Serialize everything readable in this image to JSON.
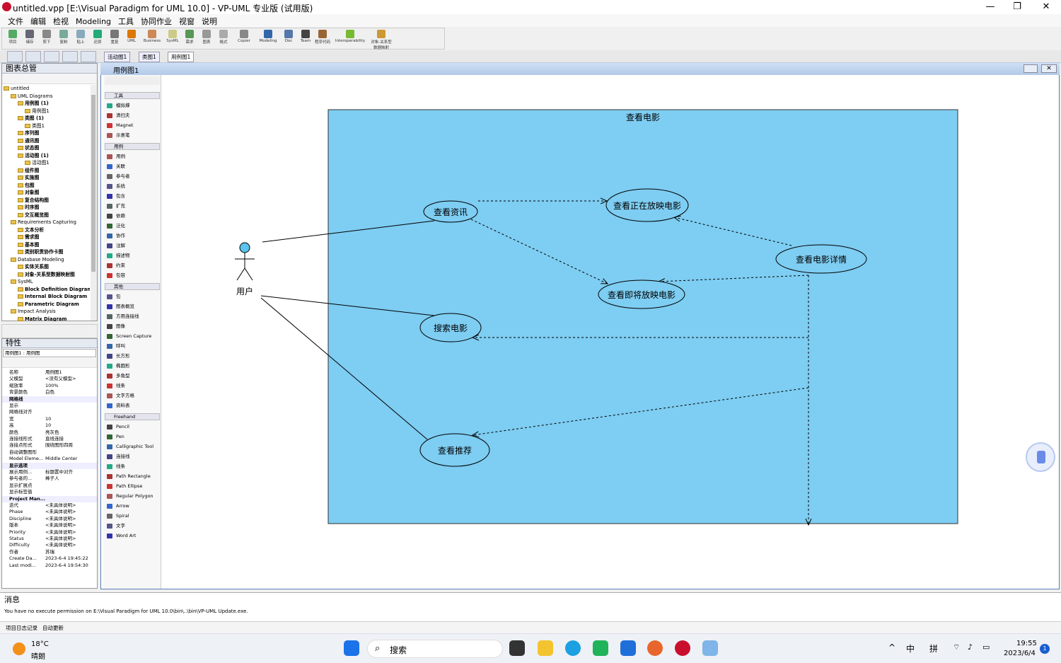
{
  "window": {
    "title": "untitled.vpp [E:\\Visual Paradigm for UML 10.0] - VP-UML 专业版 (试用版)"
  },
  "menu": [
    "文件",
    "编辑",
    "检视",
    "Modeling",
    "工具",
    "协同作业",
    "视窗",
    "说明"
  ],
  "toolbar": [
    "项目",
    "储存",
    "剪下",
    "复制",
    "贴上",
    "还原",
    "重复",
    "UML",
    "Business",
    "SysML",
    "需求",
    "图表",
    "格式",
    "Copier",
    "Modeling",
    "Doc",
    "Team",
    "程序代码",
    "Interoperability",
    "对象-关系型数据映射"
  ],
  "doc_tabs": [
    "活动图1",
    "类图1",
    "用例图1"
  ],
  "diagram_tab_title": "用例图1",
  "tree": {
    "title": "图表总管",
    "items": [
      {
        "label": "untitled",
        "level": 0,
        "bold": false
      },
      {
        "label": "UML Diagrams",
        "level": 1,
        "bold": false
      },
      {
        "label": "用例图 (1)",
        "level": 2,
        "bold": true
      },
      {
        "label": "用例图1",
        "level": 3,
        "bold": false
      },
      {
        "label": "类图 (1)",
        "level": 2,
        "bold": true
      },
      {
        "label": "类图1",
        "level": 3,
        "bold": false
      },
      {
        "label": "序列图",
        "level": 2,
        "bold": true
      },
      {
        "label": "通讯图",
        "level": 2,
        "bold": true
      },
      {
        "label": "状态图",
        "level": 2,
        "bold": true
      },
      {
        "label": "活动图 (1)",
        "level": 2,
        "bold": true
      },
      {
        "label": "活动图1",
        "level": 3,
        "bold": false
      },
      {
        "label": "组件图",
        "level": 2,
        "bold": true
      },
      {
        "label": "实施图",
        "level": 2,
        "bold": true
      },
      {
        "label": "包图",
        "level": 2,
        "bold": true
      },
      {
        "label": "对象图",
        "level": 2,
        "bold": true
      },
      {
        "label": "复合结构图",
        "level": 2,
        "bold": true
      },
      {
        "label": "时序图",
        "level": 2,
        "bold": true
      },
      {
        "label": "交互概览图",
        "level": 2,
        "bold": true
      },
      {
        "label": "Requirements Capturing",
        "level": 1,
        "bold": false
      },
      {
        "label": "文本分析",
        "level": 2,
        "bold": true
      },
      {
        "label": "需求图",
        "level": 2,
        "bold": true
      },
      {
        "label": "基本图",
        "level": 2,
        "bold": true
      },
      {
        "label": "类别职责协作卡图",
        "level": 2,
        "bold": true
      },
      {
        "label": "Database Modeling",
        "level": 1,
        "bold": false
      },
      {
        "label": "实体关系图",
        "level": 2,
        "bold": true
      },
      {
        "label": "对象-关系型数据映射图",
        "level": 2,
        "bold": true
      },
      {
        "label": "SysML",
        "level": 1,
        "bold": false
      },
      {
        "label": "Block Definition Diagram",
        "level": 2,
        "bold": true
      },
      {
        "label": "Internal Block Diagram",
        "level": 2,
        "bold": true
      },
      {
        "label": "Parametric Diagram",
        "level": 2,
        "bold": true
      },
      {
        "label": "Impact Analysis",
        "level": 1,
        "bold": false
      },
      {
        "label": "Matrix Diagram",
        "level": 2,
        "bold": true
      }
    ]
  },
  "properties": {
    "title": "特性",
    "selector": "用例图1 : 用例图",
    "rows": [
      {
        "k": "名称",
        "v": "用例图1",
        "cat": false
      },
      {
        "k": "父模型",
        "v": "<没有父模型>",
        "cat": false
      },
      {
        "k": "缩放率",
        "v": "100%",
        "cat": false
      },
      {
        "k": "背景颜色",
        "v": "白色",
        "cat": false
      },
      {
        "k": "网格线",
        "v": "",
        "cat": true
      },
      {
        "k": "显示",
        "v": "",
        "cat": false
      },
      {
        "k": "网格线对齐",
        "v": "",
        "cat": false
      },
      {
        "k": "宽",
        "v": "10",
        "cat": false
      },
      {
        "k": "高",
        "v": "10",
        "cat": false
      },
      {
        "k": "颜色",
        "v": "亮灰色",
        "cat": false
      },
      {
        "k": "连接线形式",
        "v": "直线连接",
        "cat": false
      },
      {
        "k": "连接点形式",
        "v": "围绕图形四周",
        "cat": false
      },
      {
        "k": "自动调整图形",
        "v": "",
        "cat": false
      },
      {
        "k": "Model Eleme...",
        "v": "Middle Center",
        "cat": false
      },
      {
        "k": "显示选项",
        "v": "",
        "cat": true
      },
      {
        "k": "展示用例...",
        "v": "标题置中对齐",
        "cat": false
      },
      {
        "k": "参与者的...",
        "v": "棒子人",
        "cat": false
      },
      {
        "k": "显示扩展点",
        "v": "",
        "cat": false
      },
      {
        "k": "显示标签值",
        "v": "",
        "cat": false
      },
      {
        "k": "Project Man...",
        "v": "",
        "cat": true
      },
      {
        "k": "迭代",
        "v": "<未具体说明>",
        "cat": false
      },
      {
        "k": "Phase",
        "v": "<未具体说明>",
        "cat": false
      },
      {
        "k": "Discipline",
        "v": "<未具体说明>",
        "cat": false
      },
      {
        "k": "版本",
        "v": "<未具体说明>",
        "cat": false
      },
      {
        "k": "Priority",
        "v": "<未具体说明>",
        "cat": false
      },
      {
        "k": "Status",
        "v": "<未具体说明>",
        "cat": false
      },
      {
        "k": "Difficulty",
        "v": "<未具体说明>",
        "cat": false
      },
      {
        "k": "作者",
        "v": "苏瑞",
        "cat": false
      },
      {
        "k": "Create Da...",
        "v": "2023-6-4 19:45:22",
        "cat": false
      },
      {
        "k": "Last modi...",
        "v": "2023-6-4 19:54:30",
        "cat": false
      }
    ]
  },
  "palette": {
    "groups": [
      {
        "label": "工具",
        "items": [
          "模拟撑",
          "清扫夫",
          "Magnet",
          "示意笔"
        ]
      },
      {
        "label": "用例",
        "items": [
          "用例",
          "关联",
          "参与者",
          "系统",
          "包含",
          "扩充",
          "依赖",
          "泛化",
          "协作",
          "注解",
          "描述物",
          "约束",
          "包容"
        ]
      },
      {
        "label": "其他",
        "items": [
          "包",
          "图表概览",
          "方用连接线",
          "图像",
          "Screen Capture",
          "呼叫",
          "长方形",
          "椭圆形",
          "多角型",
          "线条",
          "文字方格",
          "资料表"
        ]
      },
      {
        "label": "Freehand",
        "items": [
          "Pencil",
          "Pen",
          "Calligraphic Tool",
          "连接线",
          "线条",
          "Path Rectangle",
          "Path Ellipse",
          "Regular Polygon",
          "Arrow",
          "Spiral",
          "文字",
          "Word Art"
        ]
      }
    ]
  },
  "diagram": {
    "system_name": "查看电影",
    "actor": "用户",
    "use_cases": [
      "查看资讯",
      "查看正在放映电影",
      "查看即将放映电影",
      "查看电影详情",
      "搜索电影",
      "查看推荐"
    ]
  },
  "messages": {
    "title": "消息",
    "text": "You have no execute permission on E:\\Visual Paradigm for UML 10.0\\bin\\..\\bin\\VP-UML Update.exe.",
    "tabs": [
      "项目日志记录",
      "自动更新"
    ]
  },
  "taskbar": {
    "weather_temp": "18°C",
    "weather_desc": "晴朗",
    "search": "搜索",
    "ime1": "中",
    "ime2": "拼",
    "time": "19:55",
    "date": "2023/6/4",
    "badge": "1"
  },
  "colors": {
    "system_fill": "#7ecdf2",
    "actor_head": "#5bc3ee",
    "accent": "#5a7fb6"
  }
}
